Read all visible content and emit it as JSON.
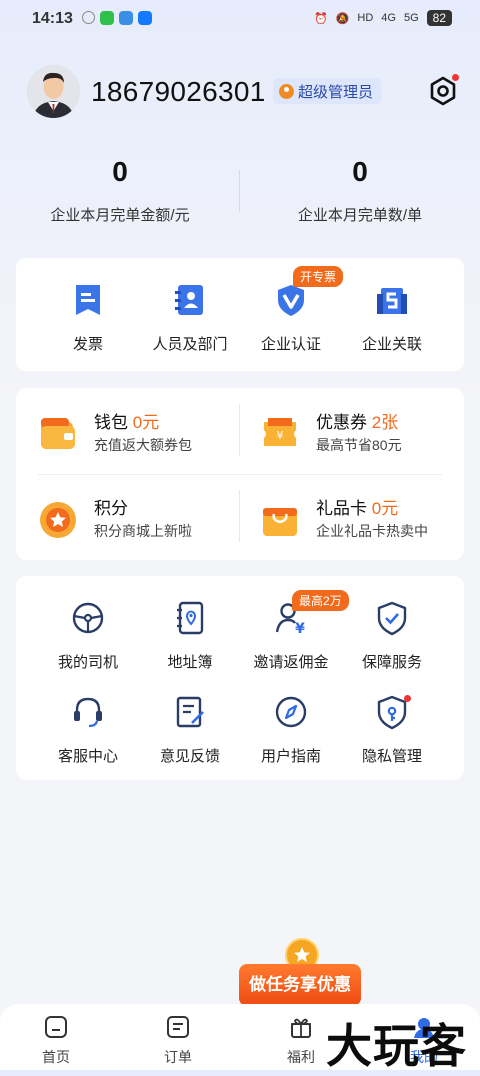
{
  "status_bar": {
    "time": "14:13",
    "battery": "82",
    "signal1": "4G",
    "signal2": "5G",
    "hd": "HD"
  },
  "profile": {
    "phone": "18679026301",
    "role": "超级管理员"
  },
  "stats": [
    {
      "value": "0",
      "label": "企业本月完单金额/元"
    },
    {
      "value": "0",
      "label": "企业本月完单数/单"
    }
  ],
  "shortcuts": [
    {
      "label": "发票",
      "icon": "invoice-icon"
    },
    {
      "label": "人员及部门",
      "icon": "staff-icon"
    },
    {
      "label": "企业认证",
      "icon": "certification-icon",
      "tag": "开专票"
    },
    {
      "label": "企业关联",
      "icon": "link-icon"
    }
  ],
  "wallet": [
    {
      "title": "钱包",
      "highlight": "0元",
      "sub": "充值返大额券包",
      "icon": "wallet-icon"
    },
    {
      "title": "优惠券",
      "highlight": "2张",
      "sub": "最高节省80元",
      "icon": "coupon-icon"
    },
    {
      "title": "积分",
      "highlight": "",
      "sub": "积分商城上新啦",
      "icon": "points-icon"
    },
    {
      "title": "礼品卡",
      "highlight": "0元",
      "sub": "企业礼品卡热卖中",
      "icon": "giftcard-icon"
    }
  ],
  "services": [
    {
      "label": "我的司机",
      "icon": "steering-wheel-icon"
    },
    {
      "label": "地址簿",
      "icon": "address-book-icon"
    },
    {
      "label": "邀请返佣金",
      "icon": "invite-icon",
      "tag": "最高2万"
    },
    {
      "label": "保障服务",
      "icon": "shield-check-icon"
    },
    {
      "label": "客服中心",
      "icon": "headset-icon"
    },
    {
      "label": "意见反馈",
      "icon": "feedback-icon"
    },
    {
      "label": "用户指南",
      "icon": "compass-icon"
    },
    {
      "label": "隐私管理",
      "icon": "privacy-icon"
    }
  ],
  "promo": {
    "label": "做任务享优惠"
  },
  "nav": [
    {
      "label": "首页",
      "icon": "home-icon"
    },
    {
      "label": "订单",
      "icon": "order-icon"
    },
    {
      "label": "福利",
      "icon": "gift-icon"
    },
    {
      "label": "我的",
      "icon": "profile-icon"
    }
  ],
  "watermark": "大玩客",
  "colors": {
    "accent": "#f06a1c",
    "primary_blue": "#2f6be5"
  }
}
